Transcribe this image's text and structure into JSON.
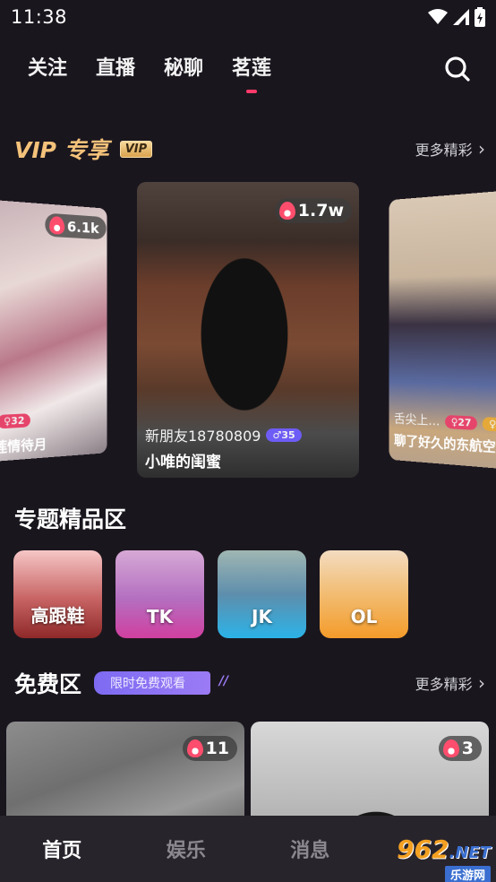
{
  "status_bar": {
    "time": "11:38"
  },
  "top_nav": {
    "tabs": [
      {
        "label": "关注"
      },
      {
        "label": "直播"
      },
      {
        "label": "秘聊"
      },
      {
        "label": "茗莲"
      }
    ],
    "active_tab": "茗莲",
    "accent_color": "#ff3a6a"
  },
  "vip_section": {
    "title": "VIP 专享",
    "badge": "VIP",
    "more_label": "更多精彩",
    "cards": [
      {
        "hot": "6.1k",
        "user": "",
        "gender_age": "♀32",
        "caption": "莲情待月"
      },
      {
        "hot": "1.7w",
        "user": "新朋友18780809",
        "gender_age": "♂35",
        "caption": "小唯的闺蜜"
      },
      {
        "hot": "",
        "user": "舌尖上…",
        "gender_age": "♀27",
        "gender_age_2": "♀",
        "caption": "聊了好久的东航空姐"
      }
    ]
  },
  "topic_section": {
    "title": "专题精品区",
    "items": [
      {
        "label": "高跟鞋"
      },
      {
        "label": "TK"
      },
      {
        "label": "JK"
      },
      {
        "label": "OL"
      }
    ]
  },
  "free_section": {
    "title": "免费区",
    "tag": "限时免费观看",
    "more_label": "更多精彩",
    "cards": [
      {
        "hot": "11"
      },
      {
        "hot": "3"
      }
    ]
  },
  "bottom_nav": {
    "items": [
      {
        "label": "首页"
      },
      {
        "label": "娱乐"
      },
      {
        "label": "消息"
      },
      {
        "label": ""
      }
    ]
  },
  "watermark": {
    "logo": "962",
    "logo_suffix": ".NET",
    "sub": "乐游网"
  }
}
